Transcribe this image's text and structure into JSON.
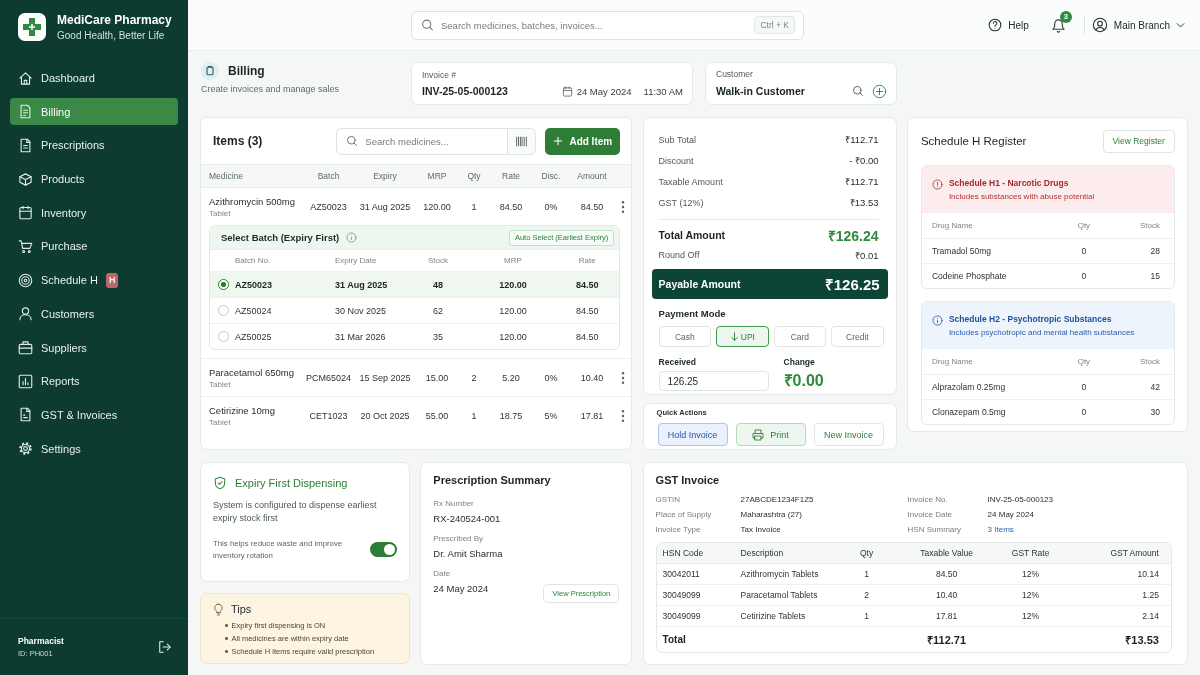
{
  "sidebar": {
    "brand": {
      "name": "MediCare Pharmacy",
      "tagline": "Good Health, Better Life"
    },
    "items": [
      {
        "label": "Dashboard",
        "selected": false
      },
      {
        "label": "Billing",
        "selected": true
      },
      {
        "label": "Prescriptions",
        "selected": false
      },
      {
        "label": "Products",
        "selected": false
      },
      {
        "label": "Inventory",
        "selected": false
      },
      {
        "label": "Purchase",
        "selected": false
      },
      {
        "label": "Schedule H",
        "selected": false,
        "badge": "H"
      },
      {
        "label": "Customers",
        "selected": false
      },
      {
        "label": "Suppliers",
        "selected": false
      },
      {
        "label": "Reports",
        "selected": false
      },
      {
        "label": "GST & Invoices",
        "selected": false
      },
      {
        "label": "Settings",
        "selected": false
      }
    ],
    "user": {
      "role": "Pharmacist",
      "id": "ID: PH001"
    }
  },
  "topbar": {
    "search": {
      "placeholder": "Search medicines, batches, invoices...",
      "shortcut": "Ctrl + K"
    },
    "help": "Help",
    "notification_count": "3",
    "branch": "Main Branch"
  },
  "page": {
    "title": "Billing",
    "subtitle": "Create invoices and manage sales"
  },
  "invoice": {
    "label": "Invoice #",
    "number": "INV-25-05-000123",
    "date": "24 May 2024",
    "time": "11:30 AM"
  },
  "customer": {
    "label": "Customer",
    "name": "Walk-in Customer"
  },
  "items": {
    "title": "Items (3)",
    "search": {
      "placeholder": "Search medicines..."
    },
    "add_button": "Add Item",
    "columns": [
      "Medicine",
      "Batch",
      "Expiry",
      "MRP",
      "Qty",
      "Rate",
      "Disc.",
      "Amount"
    ],
    "rows": [
      {
        "medicine": "Azithromycin 500mg",
        "form": "Tablet",
        "batch": "AZ50023",
        "expiry": "31 Aug 2025",
        "mrp": "120.00",
        "qty": "1",
        "rate": "84.50",
        "disc": "0%",
        "amount": "84.50",
        "batch_picker": {
          "title": "Select Batch (Expiry First)",
          "auto_select": "Auto Select (Earliest Expiry)",
          "columns": [
            "Batch No.",
            "Expiry Date",
            "Stock",
            "MRP",
            "Rate"
          ],
          "rows": [
            {
              "selected": true,
              "cells": [
                "AZ50023",
                "31 Aug 2025",
                "48",
                "120.00",
                "84.50"
              ]
            },
            {
              "selected": false,
              "cells": [
                "AZ50024",
                "30 Nov 2025",
                "62",
                "120.00",
                "84.50"
              ]
            },
            {
              "selected": false,
              "cells": [
                "AZ50025",
                "31 Mar 2026",
                "35",
                "120.00",
                "84.50"
              ]
            }
          ]
        }
      },
      {
        "medicine": "Paracetamol 650mg",
        "form": "Tablet",
        "batch": "PCM65024",
        "expiry": "15 Sep 2025",
        "mrp": "15.00",
        "qty": "2",
        "rate": "5.20",
        "disc": "0%",
        "amount": "10.40"
      },
      {
        "medicine": "Cetirizine 10mg",
        "form": "Tablet",
        "batch": "CET1023",
        "expiry": "20 Oct 2025",
        "mrp": "55.00",
        "qty": "1",
        "rate": "18.75",
        "disc": "5%",
        "amount": "17.81"
      }
    ]
  },
  "summary": {
    "lines": [
      {
        "label": "Sub Total",
        "value": "₹112.71"
      },
      {
        "label": "Discount",
        "value": "- ₹0.00"
      },
      {
        "label": "Taxable Amount",
        "value": "₹112.71"
      },
      {
        "label": "GST (12%)",
        "value": "₹13.53"
      }
    ],
    "total": {
      "label": "Total Amount",
      "value": "₹126.24"
    },
    "round_off": {
      "label": "Round Off",
      "value": "₹0.01"
    },
    "payable": {
      "label": "Payable Amount",
      "value": "₹126.25"
    },
    "payment_mode": {
      "title": "Payment Mode",
      "options": [
        {
          "label": "Cash",
          "selected": false
        },
        {
          "label": "UPI",
          "selected": true
        },
        {
          "label": "Card",
          "selected": false
        },
        {
          "label": "Credit",
          "selected": false
        }
      ]
    },
    "received": {
      "label": "Received",
      "value": "126.25"
    },
    "change": {
      "label": "Change",
      "value": "₹0.00"
    }
  },
  "quick_actions": {
    "title": "Quick Actions",
    "buttons": [
      {
        "label": "Hold Invoice",
        "kind": "hold"
      },
      {
        "label": "Print",
        "kind": "print"
      },
      {
        "label": "New Invoice",
        "kind": "new"
      }
    ]
  },
  "schedule_h": {
    "title": "Schedule H Register",
    "button": "View Register",
    "groups": [
      {
        "kind": "danger",
        "title": "Schedule H1 - Narcotic Drugs",
        "description": "Includes substances with abuse potential",
        "columns": [
          "Drug Name",
          "Qty",
          "Stock"
        ],
        "rows": [
          [
            "Tramadol 50mg",
            "0",
            "28"
          ],
          [
            "Codeine Phosphate",
            "0",
            "15"
          ]
        ]
      },
      {
        "kind": "info",
        "title": "Schedule H2 - Psychotropic Substances",
        "description": "Includes psychotropic and mental health substances",
        "columns": [
          "Drug Name",
          "Qty",
          "Stock"
        ],
        "rows": [
          [
            "Alprazolam 0.25mg",
            "0",
            "42"
          ],
          [
            "Clonazepam 0.5mg",
            "0",
            "30"
          ]
        ]
      }
    ]
  },
  "expiry_first": {
    "title": "Expiry First Dispensing",
    "description": "System is configured to dispense earliest expiry stock first",
    "note": "This helps reduce waste and improve inventory rotation",
    "on": true
  },
  "tips": {
    "title": "Tips",
    "items": [
      "Expiry first dispensing is ON",
      "All medicines are within expiry date",
      "Schedule H items require valid prescription"
    ]
  },
  "prescription": {
    "title": "Prescription Summary",
    "fields": [
      {
        "label": "Rx Number",
        "value": "RX-240524-001"
      },
      {
        "label": "Prescribed By",
        "value": "Dr. Amit Sharma"
      },
      {
        "label": "Date",
        "value": "24 May 2024"
      }
    ],
    "button": "View Prescription"
  },
  "gst_invoice": {
    "title": "GST Invoice",
    "details": [
      {
        "label": "GSTIN",
        "value": "27ABCDE1234F1Z5",
        "kind": "text"
      },
      {
        "label": "Invoice No.",
        "value": "INV-25-05-000123",
        "kind": "text"
      },
      {
        "label": "Place of Supply",
        "value": "Maharashtra (27)",
        "kind": "text"
      },
      {
        "label": "Invoice Date",
        "value": "24 May 2024",
        "kind": "text"
      },
      {
        "label": "Invoice Type",
        "value": "Tax Invoice",
        "kind": "text"
      },
      {
        "label": "HSN Summary",
        "value": "3 Items",
        "kind": "link"
      }
    ],
    "table": {
      "columns": [
        "HSN Code",
        "Description",
        "Qty",
        "Taxable Value",
        "GST Rate",
        "GST Amount"
      ],
      "rows": [
        [
          "30042011",
          "Azithromycin Tablets",
          "1",
          "84.50",
          "12%",
          "10.14"
        ],
        [
          "30049099",
          "Paracetamol Tablets",
          "2",
          "10.40",
          "12%",
          "1.25"
        ],
        [
          "30049099",
          "Cetirizine Tablets",
          "1",
          "17.81",
          "12%",
          "2.14"
        ]
      ],
      "total": {
        "label": "Total",
        "taxable_value": "₹112.71",
        "gst_amount": "₹13.53"
      }
    }
  }
}
